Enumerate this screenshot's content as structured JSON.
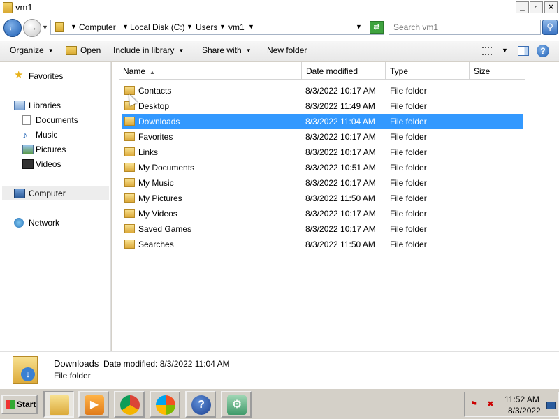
{
  "window": {
    "title": "vm1"
  },
  "address": {
    "crumbs": [
      "Computer",
      "Local Disk (C:)",
      "Users",
      "vm1"
    ],
    "search_placeholder": "Search vm1"
  },
  "toolbar": {
    "organize": "Organize",
    "open": "Open",
    "include_in_library": "Include in library",
    "share_with": "Share with",
    "new_folder": "New folder"
  },
  "nav": {
    "favorites": "Favorites",
    "libraries": "Libraries",
    "documents": "Documents",
    "music": "Music",
    "pictures": "Pictures",
    "videos": "Videos",
    "computer": "Computer",
    "network": "Network"
  },
  "columns": {
    "name": "Name",
    "date_modified": "Date modified",
    "type": "Type",
    "size": "Size"
  },
  "files": [
    {
      "name": "Contacts",
      "date": "8/3/2022 10:17 AM",
      "type": "File folder"
    },
    {
      "name": "Desktop",
      "date": "8/3/2022 11:49 AM",
      "type": "File folder"
    },
    {
      "name": "Downloads",
      "date": "8/3/2022 11:04 AM",
      "type": "File folder"
    },
    {
      "name": "Favorites",
      "date": "8/3/2022 10:17 AM",
      "type": "File folder"
    },
    {
      "name": "Links",
      "date": "8/3/2022 10:17 AM",
      "type": "File folder"
    },
    {
      "name": "My Documents",
      "date": "8/3/2022 10:51 AM",
      "type": "File folder"
    },
    {
      "name": "My Music",
      "date": "8/3/2022 10:17 AM",
      "type": "File folder"
    },
    {
      "name": "My Pictures",
      "date": "8/3/2022 11:50 AM",
      "type": "File folder"
    },
    {
      "name": "My Videos",
      "date": "8/3/2022 10:17 AM",
      "type": "File folder"
    },
    {
      "name": "Saved Games",
      "date": "8/3/2022 10:17 AM",
      "type": "File folder"
    },
    {
      "name": "Searches",
      "date": "8/3/2022 11:50 AM",
      "type": "File folder"
    }
  ],
  "selected_file": "Downloads",
  "details": {
    "name": "Downloads",
    "date_label": "Date modified:",
    "date_value": "8/3/2022 11:04 AM",
    "type": "File folder"
  },
  "taskbar": {
    "start": "Start",
    "apps": [
      "windows-explorer-icon",
      "media-player-icon",
      "chrome-icon",
      "windows-icon",
      "help-icon",
      "virtual-machine-icon"
    ],
    "time": "11:52 AM",
    "date": "8/3/2022"
  },
  "colors": {
    "selection": "#3399ff",
    "titlebar": "#ffffff"
  }
}
